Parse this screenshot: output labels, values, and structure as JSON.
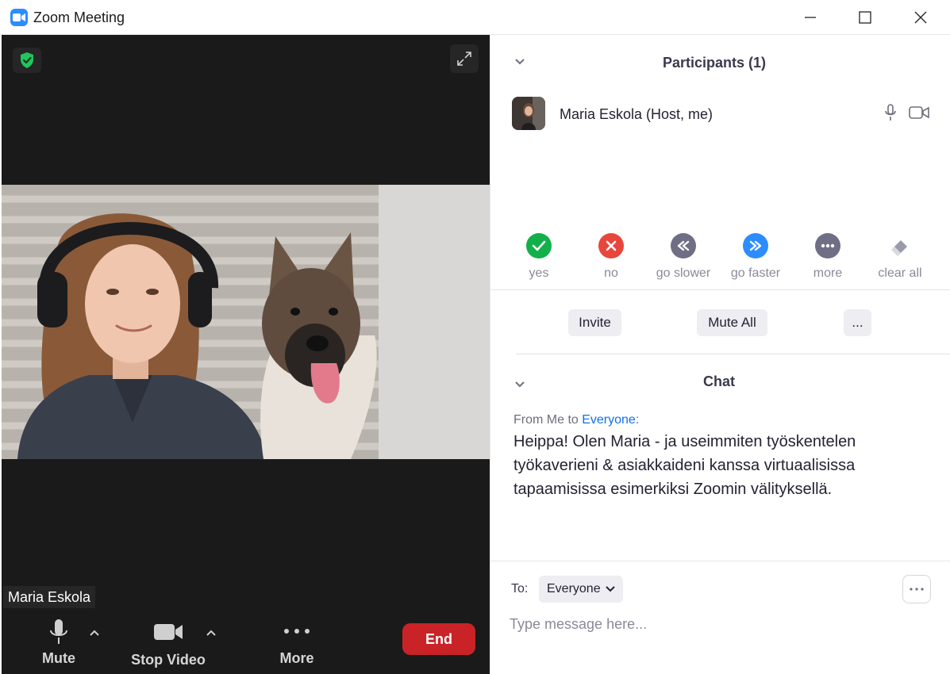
{
  "window": {
    "title": "Zoom Meeting"
  },
  "video": {
    "participant_name": "Maria Eskola"
  },
  "toolbar": {
    "mute_label": "Mute",
    "stop_video_label": "Stop Video",
    "more_label": "More",
    "end_label": "End"
  },
  "participants": {
    "title": "Participants (1)",
    "list": [
      {
        "name": "Maria Eskola (Host, me)"
      }
    ],
    "reactions": [
      {
        "label": "yes",
        "icon": "check-icon",
        "color": "#12b04a"
      },
      {
        "label": "no",
        "icon": "x-icon",
        "color": "#e8463c"
      },
      {
        "label": "go slower",
        "icon": "rewind-icon",
        "color": "#6e6e85"
      },
      {
        "label": "go faster",
        "icon": "fast-forward-icon",
        "color": "#2d8cff"
      },
      {
        "label": "more",
        "icon": "dots-icon",
        "color": "#6e6e85"
      },
      {
        "label": "clear all",
        "icon": "eraser-icon",
        "color": "#9a9aaa"
      }
    ],
    "buttons": {
      "invite": "Invite",
      "mute_all": "Mute All",
      "more": "..."
    }
  },
  "chat": {
    "title": "Chat",
    "messages": [
      {
        "from_prefix": "From Me to ",
        "recipient": "Everyone",
        "suffix": ":",
        "text": "Heippa! Olen Maria - ja useimmiten työskentelen työkaverieni & asiakkaideni kanssa virtuaalisissa tapaamisissa esimerkiksi Zoomin välityksellä."
      }
    ],
    "to_label": "To:",
    "to_value": "Everyone",
    "placeholder": "Type message here..."
  },
  "colors": {
    "accent": "#2d8cff",
    "end": "#c92327",
    "shield": "#22c55e"
  }
}
